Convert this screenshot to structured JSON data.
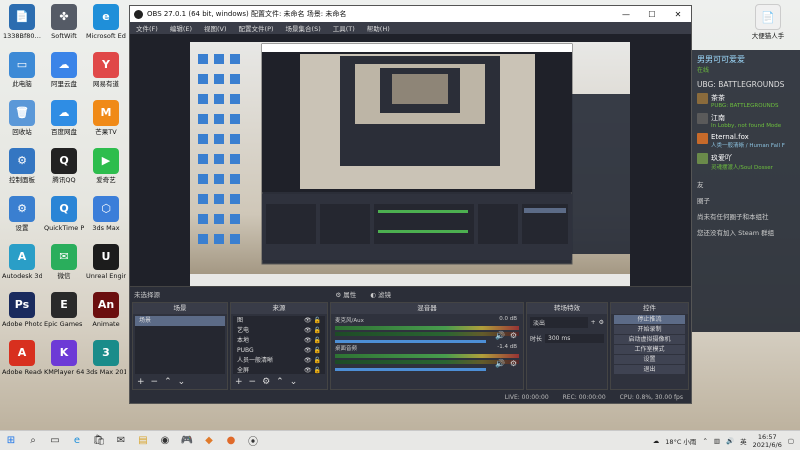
{
  "desktop_icons": [
    {
      "label": "1338Bf80…",
      "color": "#2c6db0",
      "glyph": "📄"
    },
    {
      "label": "SoftWift",
      "color": "#555b66",
      "glyph": "✤"
    },
    {
      "label": "Microsoft Edge",
      "color": "#1f8fd9",
      "glyph": "e"
    },
    {
      "label": "此电脑",
      "color": "#3d8ad6",
      "glyph": "▭"
    },
    {
      "label": "阿里云盘",
      "color": "#3b84e8",
      "glyph": "☁"
    },
    {
      "label": "网易有道",
      "color": "#e04848",
      "glyph": "Y"
    },
    {
      "label": "回收站",
      "color": "#5b98d8",
      "glyph": "🗑"
    },
    {
      "label": "百度网盘",
      "color": "#2f8de4",
      "glyph": "☁"
    },
    {
      "label": "芒果TV",
      "color": "#f08a17",
      "glyph": "M"
    },
    {
      "label": "控制面板",
      "color": "#3476c2",
      "glyph": "⚙"
    },
    {
      "label": "腾讯QQ",
      "color": "#222222",
      "glyph": "Q"
    },
    {
      "label": "爱奇艺",
      "color": "#2dbd4d",
      "glyph": "▶"
    },
    {
      "label": "设置",
      "color": "#3a7fd0",
      "glyph": "⚙"
    },
    {
      "label": "QuickTime Player",
      "color": "#2a85d6",
      "glyph": "Q"
    },
    {
      "label": "3ds Max",
      "color": "#3b7ed9",
      "glyph": "⬡"
    },
    {
      "label": "Autodesk 3ds Max 2019",
      "color": "#2a9ec7",
      "glyph": "A"
    },
    {
      "label": "微信",
      "color": "#2aae5c",
      "glyph": "✉"
    },
    {
      "label": "Unreal Engine",
      "color": "#1c1c1c",
      "glyph": "U"
    },
    {
      "label": "Adobe Photoshop",
      "color": "#1a2b5e",
      "glyph": "Ps"
    },
    {
      "label": "Epic Games Launcher",
      "color": "#2a2a2a",
      "glyph": "E"
    },
    {
      "label": "Animate",
      "color": "#6b0f0f",
      "glyph": "An"
    },
    {
      "label": "Adobe Reader XI",
      "color": "#d8301f",
      "glyph": "A"
    },
    {
      "label": "KMPlayer 64X",
      "color": "#6d3ad6",
      "glyph": "K"
    },
    {
      "label": "3ds Max 2019",
      "color": "#1a8c8a",
      "glyph": "3"
    }
  ],
  "obs": {
    "title": "OBS 27.0.1 (64 bit, windows)  配置文件: 未命名  场景: 未命名",
    "menu": [
      "文件(F)",
      "编辑(E)",
      "视图(V)",
      "配置文件(P)",
      "场景集合(S)",
      "工具(T)",
      "帮助(H)"
    ],
    "scene_label": "未选择源",
    "props_label": "属性",
    "filters_label": "滤镜",
    "docks": {
      "scenes": {
        "title": "场景",
        "items": [
          "场景"
        ]
      },
      "sources": {
        "title": "来源",
        "items": [
          "图",
          "艺电",
          "本地",
          "PUBG",
          "人员一般清晰",
          "全屏"
        ]
      },
      "mixer": {
        "title": "混音器",
        "tracks": [
          {
            "name": "麦克风/Aux",
            "db": "0.0 dB"
          },
          {
            "name": "桌面音频",
            "db": "-1.4 dB"
          }
        ]
      },
      "transitions": {
        "title": "转场特效",
        "type": "淡出",
        "duration_label": "时长",
        "duration": "300 ms"
      },
      "controls": {
        "title": "控件",
        "buttons": [
          "停止推流",
          "开始录制",
          "启动虚拟摄像机",
          "工作室模式",
          "设置",
          "退出"
        ]
      }
    },
    "status": {
      "live": "LIVE: 00:00:00",
      "rec": "REC: 00:00:00",
      "cpu": "CPU: 0.8%, 30.00 fps"
    }
  },
  "steam": {
    "me_name": "男男可可爱爱",
    "me_status": "在线",
    "group_title": "UBG: BATTLEGROUNDS",
    "friends": [
      {
        "name": "茶茶",
        "status": "PUBG: BATTLEGROUNDS",
        "blue": false
      },
      {
        "name": "江南",
        "status": "In Lobby, not found Mode",
        "blue": false
      },
      {
        "name": "Eternal.fox",
        "status": "人类一般清晰 / Human Fall F",
        "blue": true
      },
      {
        "name": "玖爱吖",
        "status": "灵魂摆渡人/Soul Dosser",
        "blue": false
      }
    ],
    "sections": [
      "友",
      "圈子",
      "尚未有任何圈子和本组社",
      "您还没有加入 Steam 群组"
    ]
  },
  "taskbar": {
    "weather": "18°C 小雨",
    "time": "16:57",
    "date": "2021/6/6",
    "lang": "英"
  },
  "recycle_label": "大便猫人手"
}
